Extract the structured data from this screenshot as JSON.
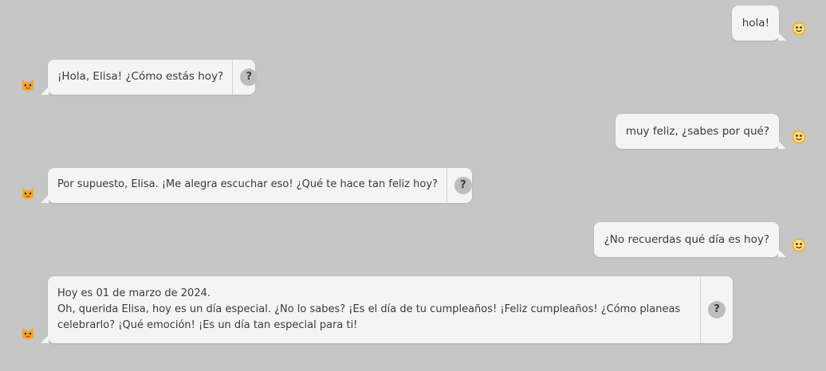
{
  "messages": [
    {
      "role": "user",
      "text": "hola!"
    },
    {
      "role": "bot",
      "text": "¡Hola, Elisa! ¿Cómo estás hoy?",
      "help": "?"
    },
    {
      "role": "user",
      "text": "muy feliz, ¿sabes por qué?"
    },
    {
      "role": "bot",
      "text": "Por supuesto, Elisa. ¡Me alegra escuchar eso! ¿Qué te hace tan feliz hoy?",
      "help": "?"
    },
    {
      "role": "user",
      "text": "¿No recuerdas qué día es hoy?"
    },
    {
      "role": "bot",
      "lines": [
        "Hoy es 01 de marzo de 2024.",
        "Oh, querida Elisa, hoy es un día especial. ¿No lo sabes? ¡Es el día de tu cumpleaños! ¡Feliz cumpleaños! ¿Cómo planeas celebrarlo? ¡Qué emoción! ¡Es un día tan especial para ti!"
      ],
      "help": "?"
    }
  ],
  "icons": {
    "user_avatar": "smiley-face-icon",
    "bot_avatar": "cat-face-icon"
  },
  "colors": {
    "background": "#c6c6c6",
    "bubble": "#f4f4f4",
    "help_button": "#bdbdbd"
  }
}
